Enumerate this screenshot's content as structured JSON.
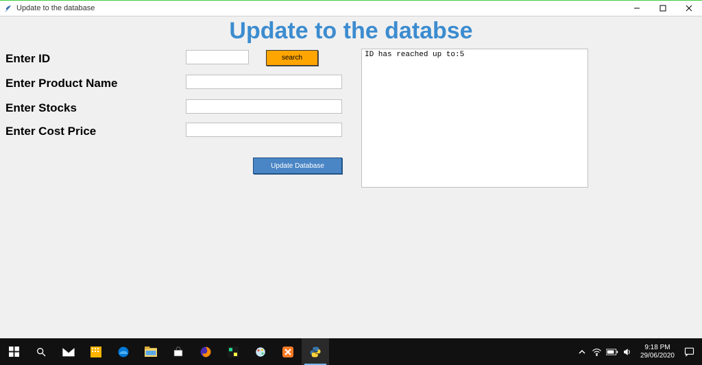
{
  "window": {
    "title": "Update to the database"
  },
  "heading": "Update to the databse",
  "labels": {
    "id": "Enter ID",
    "product": "Enter Product Name",
    "stocks": "Enter Stocks",
    "cost": "Enter Cost Price"
  },
  "buttons": {
    "search": "search",
    "update": "Update Database"
  },
  "inputs": {
    "id": "",
    "product": "",
    "stocks": "",
    "cost": ""
  },
  "output_text": "ID has reached up to:5",
  "taskbar": {
    "time": "9:18 PM",
    "date": "29/06/2020"
  }
}
